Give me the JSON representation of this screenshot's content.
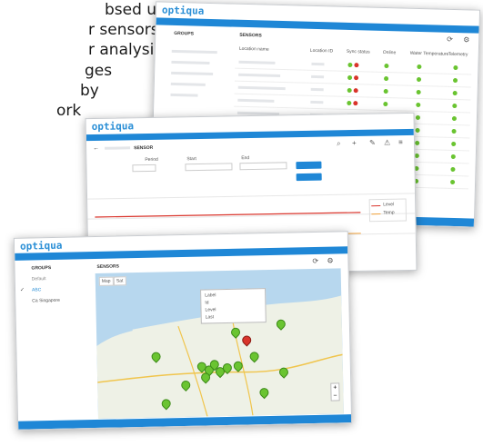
{
  "doc_lines": [
    "bsed user",
    "r sensors",
    "r analysis",
    "ges",
    "by",
    "ork"
  ],
  "brand": "optiqua",
  "colors": {
    "accent": "#1f87d6",
    "ok": "#6ac431",
    "red": "#d9342b"
  },
  "back_window": {
    "groups_header": "GROUPS",
    "sensors_header": "SENSORS",
    "columns": [
      "Location name",
      "Location ID",
      "Sync status",
      "Online",
      "Water Temperature",
      "Telemetry"
    ],
    "row_count": 10
  },
  "middle_window": {
    "sensor_title": "SENSOR",
    "fields": [
      "Period",
      "Start",
      "End"
    ],
    "legend": [
      "Level",
      "Temp"
    ]
  },
  "front_window": {
    "groups_header": "GROUPS",
    "sensors_header": "SENSORS",
    "group_items": [
      "Default",
      "ABC",
      "Ca Singapore"
    ],
    "map_tabs": [
      "Map",
      "Sat"
    ],
    "popup_lines": [
      "Label",
      "Id",
      "Level",
      "Last"
    ]
  }
}
